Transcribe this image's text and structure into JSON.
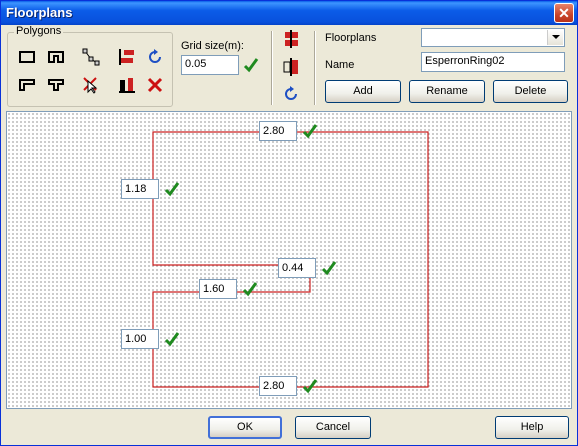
{
  "window": {
    "title": "Floorplans",
    "close_glyph": "✕"
  },
  "polygons": {
    "label": "Polygons"
  },
  "grid": {
    "label": "Grid size(m):",
    "value": "0.05"
  },
  "floorplans": {
    "label": "Floorplans",
    "selected": ""
  },
  "name": {
    "label": "Name",
    "value": "EsperronRing02"
  },
  "buttons": {
    "add": "Add",
    "rename": "Rename",
    "delete": "Delete",
    "ok": "OK",
    "cancel": "Cancel",
    "help": "Help"
  },
  "dimensions": {
    "top": "2.80",
    "left_upper": "1.18",
    "step": "0.44",
    "mid": "1.60",
    "left_lower": "1.00",
    "bottom": "2.80"
  },
  "colors": {
    "accent": "#1f8a1f",
    "outline": "#cc2222",
    "delete": "#cc1111",
    "rotate": "#1d4fc4"
  }
}
